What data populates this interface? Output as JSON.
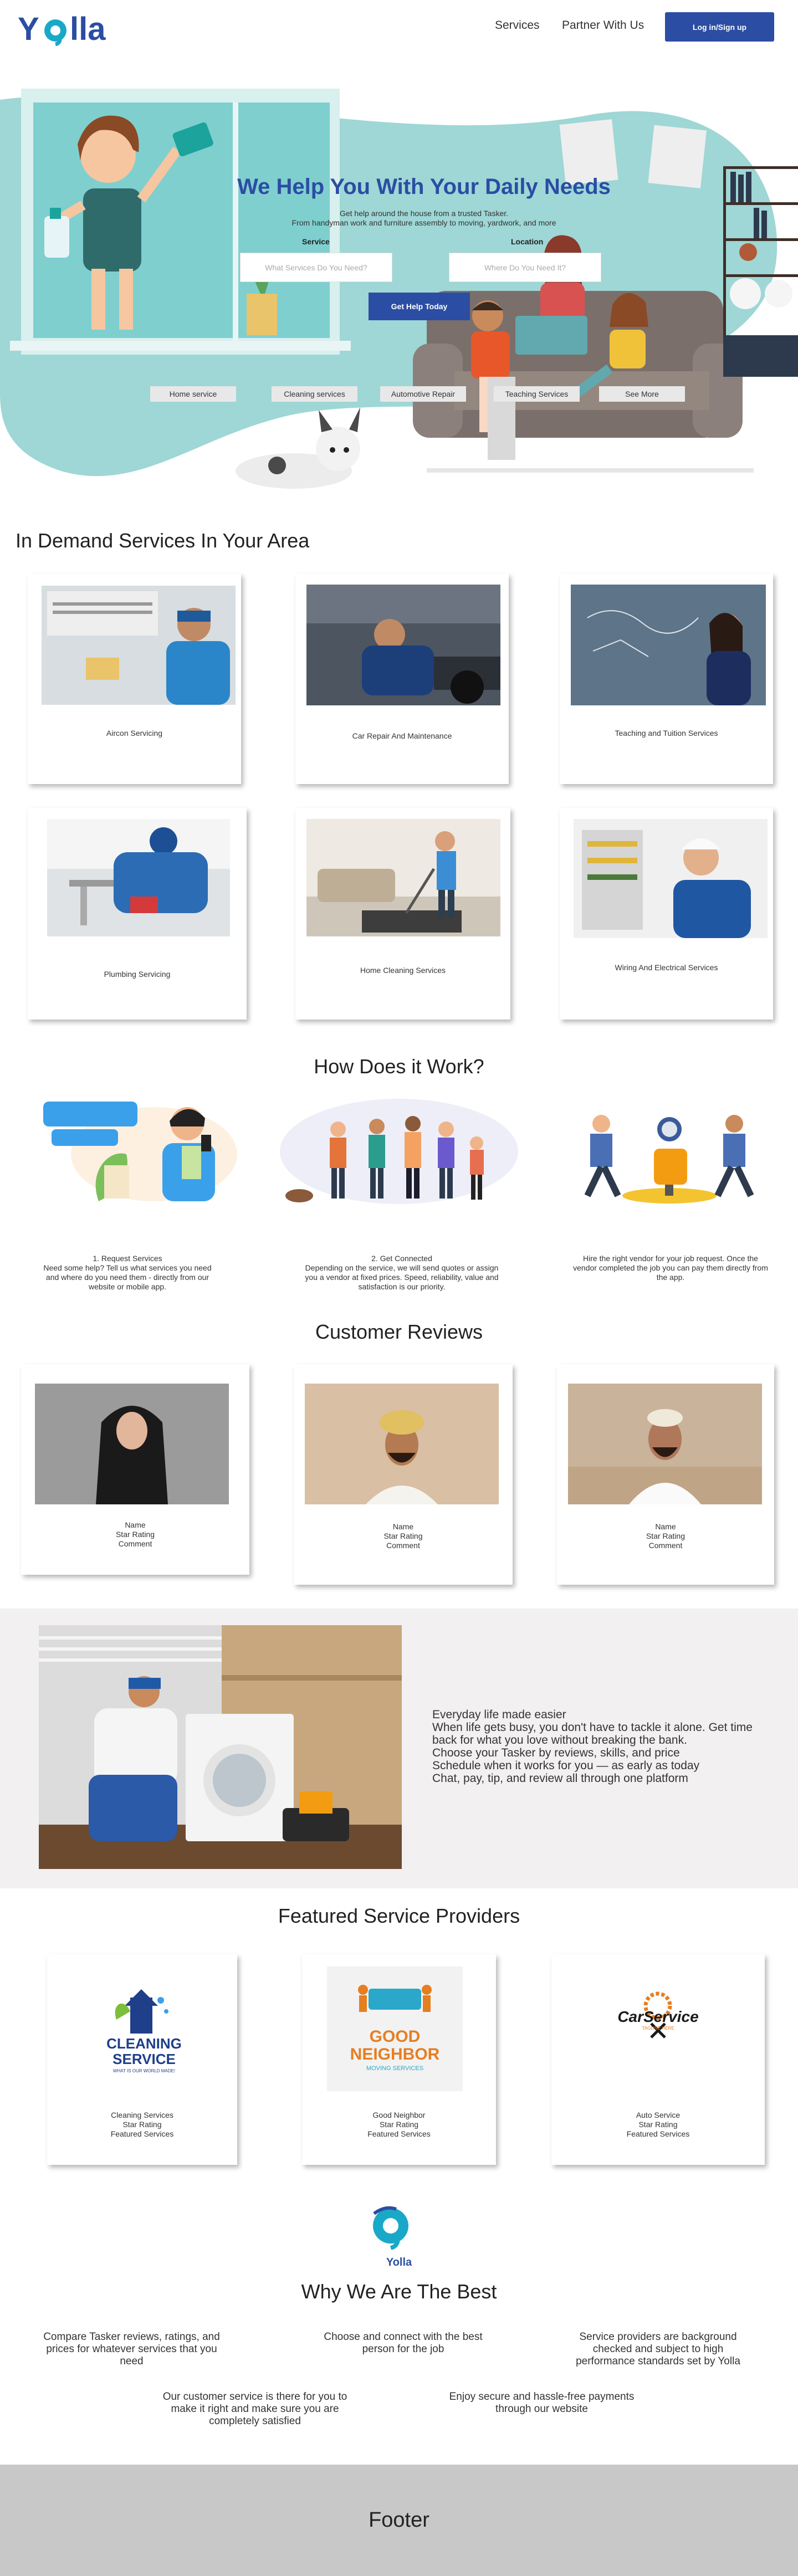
{
  "header": {
    "logo_text": "Yolla",
    "nav": [
      "Services",
      "Partner With Us"
    ],
    "login_label": "Log in/Sign up"
  },
  "hero": {
    "title": "We Help You With Your Daily Needs",
    "subtitle_line1": "Get help around the house from a trusted Tasker.",
    "subtitle_line2": "From handyman work and furniture assembly to moving, yardwork, and more",
    "service_label": "Service",
    "service_placeholder": "What Services Do You Need?",
    "location_label": "Location",
    "location_placeholder": "Where Do You Need It?",
    "cta_label": "Get Help Today",
    "chips": [
      "Home service",
      "Cleaning  services",
      "Automotive Repair",
      "Teaching Services",
      "See More"
    ]
  },
  "in_demand": {
    "title": "In Demand Services In Your Area",
    "services": [
      "Aircon Servicing",
      "Car Repair And Maintenance",
      "Teaching and Tuition Services",
      "Plumbing  Servicing",
      "Home Cleaning  Services",
      "Wiring And Electrical  Services"
    ]
  },
  "how": {
    "title": "How Does it Work?",
    "steps": [
      {
        "heading": "1. Request Services",
        "text": "Need some help? Tell us what services you need and where do you need them - directly from our website or mobile app."
      },
      {
        "heading": "2. Get Connected",
        "text": "Depending on the service, we will send quotes or assign you a vendor at fixed prices. Speed, reliability, value and satisfaction is our priority."
      },
      {
        "heading": "",
        "text": "Hire the right vendor for your job request. Once the vendor completed the job you can pay them directly from the app."
      }
    ]
  },
  "reviews": {
    "title": "Customer Reviews",
    "items": [
      {
        "name": "Name",
        "rating": "Star Rating",
        "comment": "Comment"
      },
      {
        "name": "Name",
        "rating": "Star Rating",
        "comment": "Comment"
      },
      {
        "name": "Name",
        "rating": "Star Rating",
        "comment": "Comment"
      }
    ]
  },
  "band": {
    "lines": [
      "Everyday life made easier",
      "When life gets busy, you don't have to tackle it alone. Get time back for what you love without breaking the bank.",
      "Choose your Tasker by reviews, skills, and price",
      "Schedule when it works for you — as early as today",
      "Chat, pay, tip, and review all through one platform"
    ]
  },
  "providers": {
    "title": "Featured  Service Providers",
    "items": [
      {
        "name": "Cleaning Services",
        "rating": "Star Rating",
        "featured": "Featured Services",
        "logo_main": "CLEANING",
        "logo_sub": "SERVICE",
        "logo_tag": "WHAT IS OUR WORLD MADE!"
      },
      {
        "name": "Good Neighbor",
        "rating": "Star Rating",
        "featured": "Featured Services",
        "logo_main": "GOOD",
        "logo_sub": "NEIGHBOR",
        "logo_tag": "MOVING SERVICES"
      },
      {
        "name": "Auto Service",
        "rating": "Star Rating",
        "featured": "Featured Services",
        "logo_main": "CarService",
        "logo_sub": "",
        "logo_tag": "TAGLINE HERE"
      }
    ]
  },
  "why": {
    "logo_text": "Yolla",
    "title": "Why We Are The Best",
    "points": [
      "Compare Tasker reviews, ratings, and prices for whatever services that you need",
      "Choose and connect with the best person for the job",
      "Service providers are background checked and subject to high performance standards set by Yolla",
      "Our customer service is there for you to make it right and make sure you are completely satisfied",
      "Enjoy secure and hassle-free payments through our website"
    ]
  },
  "footer": {
    "label": "Footer"
  },
  "colors": {
    "brand_blue": "#2b4da3",
    "teal": "#9ed7d5",
    "band_gray": "#f2f0f0",
    "footer_gray": "#c8c8c8"
  }
}
